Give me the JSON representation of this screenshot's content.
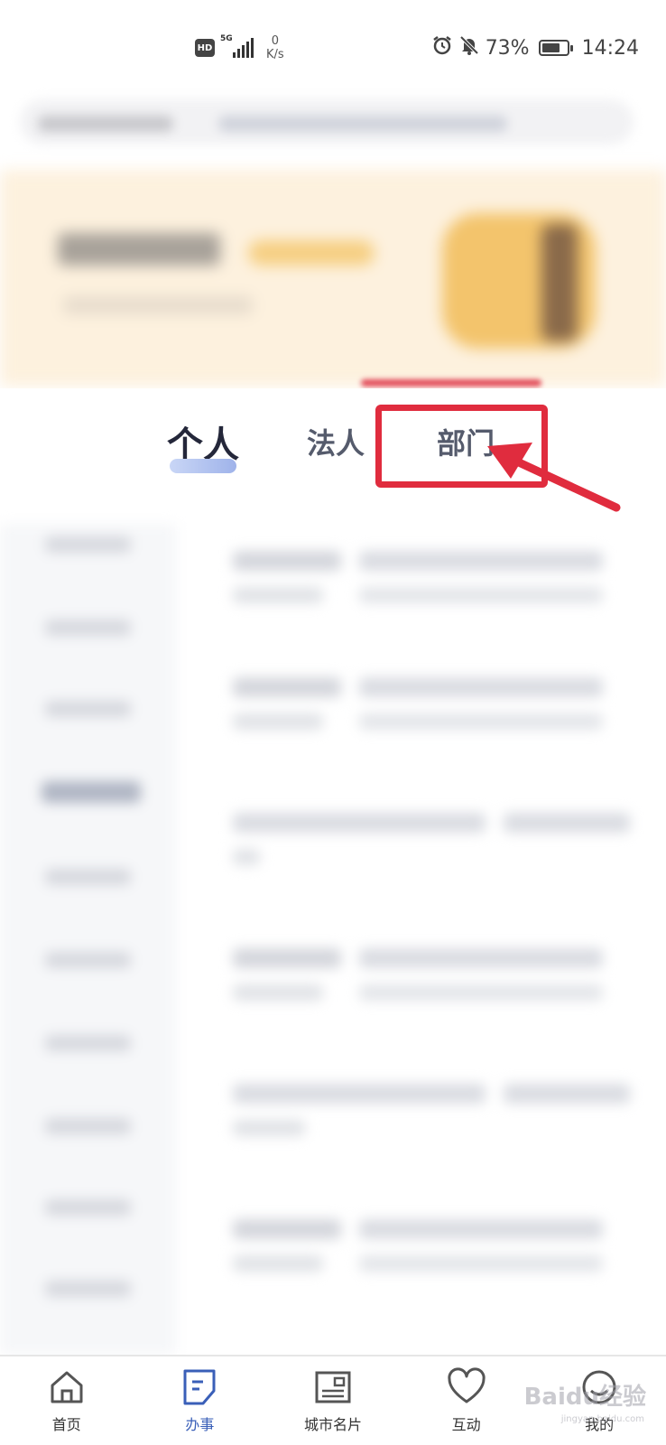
{
  "status_bar": {
    "hd": "HD",
    "network": "5G",
    "speed_value": "0",
    "speed_unit": "K/s",
    "battery": "73%",
    "battery_level": 0.73,
    "time": "14:24"
  },
  "tabs": [
    {
      "label": "个人",
      "active": true
    },
    {
      "label": "法人",
      "active": false
    },
    {
      "label": "部门",
      "active": false
    }
  ],
  "annotation": {
    "color": "#e02c3e"
  },
  "bottom_nav": [
    {
      "label": "首页",
      "icon": "home-icon",
      "active": false
    },
    {
      "label": "办事",
      "icon": "document-icon",
      "active": true
    },
    {
      "label": "城市名片",
      "icon": "city-card-icon",
      "active": false
    },
    {
      "label": "互动",
      "icon": "heart-icon",
      "active": false
    },
    {
      "label": "我的",
      "icon": "profile-icon",
      "active": false
    }
  ],
  "watermark": {
    "text": "Baidu经验",
    "sub": "jingyan.baidu.com"
  },
  "colors": {
    "accent": "#3a5fb8",
    "tab_active": "#24273a",
    "tab_inactive": "#555b6c"
  }
}
